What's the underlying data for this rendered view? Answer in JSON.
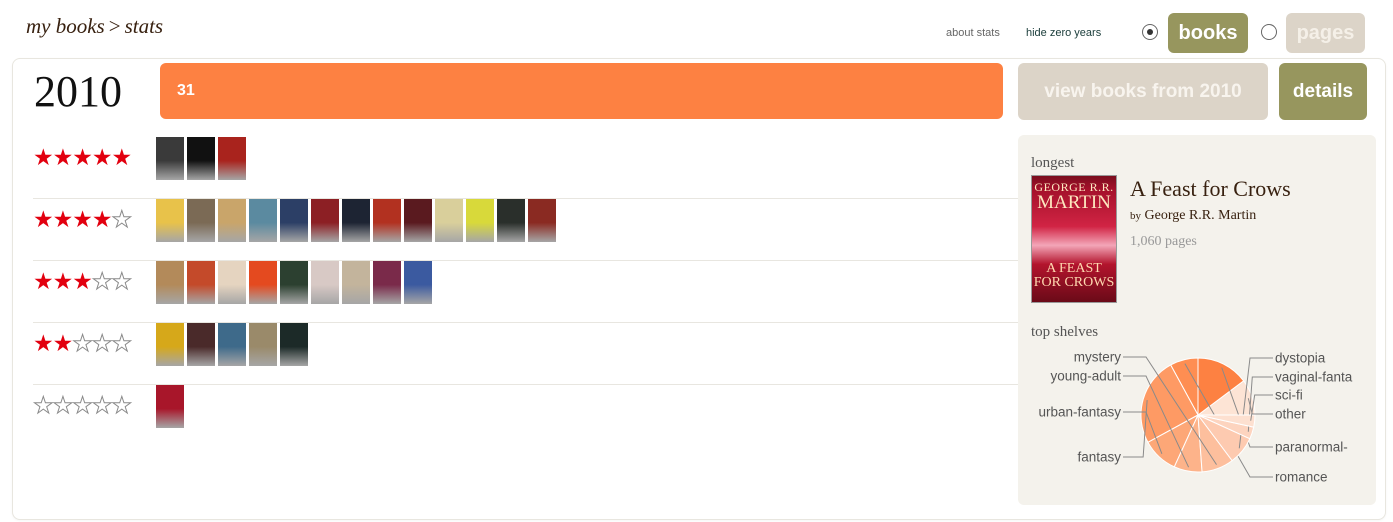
{
  "breadcrumb": {
    "part1": "my books",
    "sep": ">",
    "part2": "stats"
  },
  "toolbar": {
    "about_stats": "about stats",
    "hide_zero_years": "hide zero years",
    "books_label": "books",
    "pages_label": "pages",
    "selected_mode": "books"
  },
  "year_row": {
    "year": "2010",
    "count": "31",
    "view_books_label": "view books from 2010",
    "details_label": "details"
  },
  "ratings": [
    {
      "rating": 5,
      "stars": 5,
      "count": 3,
      "covers": [
        "#3a3a3a",
        "#111111",
        "#a9231d"
      ]
    },
    {
      "rating": 4,
      "stars": 4,
      "count": 14,
      "covers": [
        "#e8c24a",
        "#7b6a55",
        "#c9a56a",
        "#5b8aa0",
        "#2c3f66",
        "#8c1f24",
        "#1d2433",
        "#b23120",
        "#5a1a1f",
        "#d9cf9b",
        "#d8d93a",
        "#2a2f2b",
        "#8a2a22"
      ]
    },
    {
      "rating": 3,
      "stars": 3,
      "count": 9,
      "covers": [
        "#b38a5a",
        "#c44a2a",
        "#e5d4c0",
        "#e44a1f",
        "#2c4030",
        "#d8c9c5",
        "#c3b49c",
        "#7a2a4a",
        "#3b5aa0"
      ]
    },
    {
      "rating": 2,
      "stars": 2,
      "count": 5,
      "covers": [
        "#d6a81a",
        "#4a2a2a",
        "#3e6a8a",
        "#9a8a6a",
        "#1c2a28"
      ]
    },
    {
      "rating": 0,
      "stars": 0,
      "count": 1,
      "covers": [
        "#a8162a"
      ]
    }
  ],
  "sidebar": {
    "longest_label": "longest",
    "book_title": "A Feast for Crows",
    "author_by": "by",
    "author": "George R.R. Martin",
    "pages": "1,060 pages",
    "cover_line1": "GEORGE R.R.",
    "cover_line2": "MARTIN",
    "cover_line3": "A FEAST FOR CROWS",
    "top_shelves_label": "top shelves"
  },
  "chart_data": {
    "type": "pie",
    "title": "top shelves",
    "slices": [
      {
        "label": "other",
        "value": 9.0,
        "color": "#fde4d5"
      },
      {
        "label": "paranormal-",
        "value": 13.0,
        "color": "#fd8142"
      },
      {
        "label": "romance",
        "value": 7.0,
        "color": "#fe8e52"
      },
      {
        "label": "fantasy",
        "value": 22.0,
        "color": "#fe9a64"
      },
      {
        "label": "urban-fantasy",
        "value": 9.0,
        "color": "#fda777"
      },
      {
        "label": "young-adult",
        "value": 7.0,
        "color": "#fdb38a"
      },
      {
        "label": "mystery",
        "value": 8.0,
        "color": "#fdbf9d"
      },
      {
        "label": "dystopia",
        "value": 7.0,
        "color": "#fdcab0"
      },
      {
        "label": "vaginal-fanta",
        "value": 3.0,
        "color": "#fdd4bf"
      },
      {
        "label": "sci-fi",
        "value": 3.0,
        "color": "#fde0d0"
      }
    ]
  }
}
